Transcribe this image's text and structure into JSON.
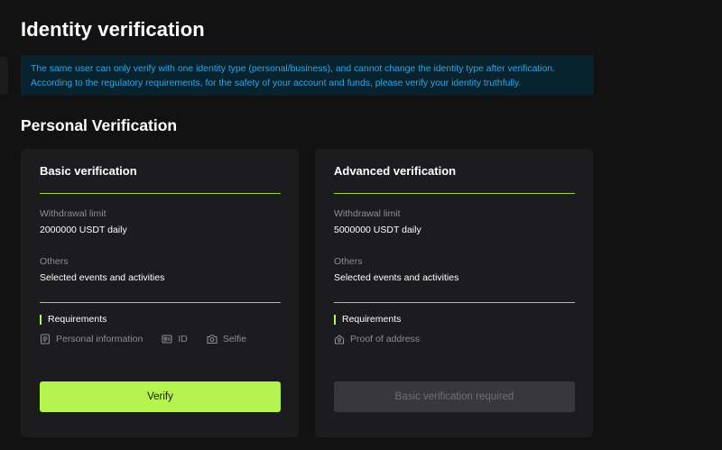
{
  "page": {
    "title": "Identity verification"
  },
  "notice": {
    "line1": "The same user can only verify with one identity type (personal/business), and cannot change the identity type after verification.",
    "line2": "According to the regulatory requirements, for the safety of your account and funds, please verify your identity truthfully."
  },
  "section": {
    "title": "Personal Verification"
  },
  "colors": {
    "accent": "#b5f34f",
    "notice_text": "#2ea6e6",
    "card_bg": "#1c1c1f"
  },
  "cards": {
    "basic": {
      "title": "Basic verification",
      "withdrawal_label": "Withdrawal limit",
      "withdrawal_value": "2000000 USDT daily",
      "others_label": "Others",
      "others_value": "Selected events and activities",
      "requirements_label": "Requirements",
      "requirements": [
        {
          "label": "Personal information",
          "icon": "document-icon"
        },
        {
          "label": "ID",
          "icon": "id-card-icon"
        },
        {
          "label": "Selfie",
          "icon": "camera-icon"
        }
      ],
      "button_label": "Verify"
    },
    "advanced": {
      "title": "Advanced verification",
      "withdrawal_label": "Withdrawal limit",
      "withdrawal_value": "5000000 USDT daily",
      "others_label": "Others",
      "others_value": "Selected events and activities",
      "requirements_label": "Requirements",
      "requirements": [
        {
          "label": "Proof of address",
          "icon": "address-icon"
        }
      ],
      "button_label": "Basic verification required"
    }
  }
}
